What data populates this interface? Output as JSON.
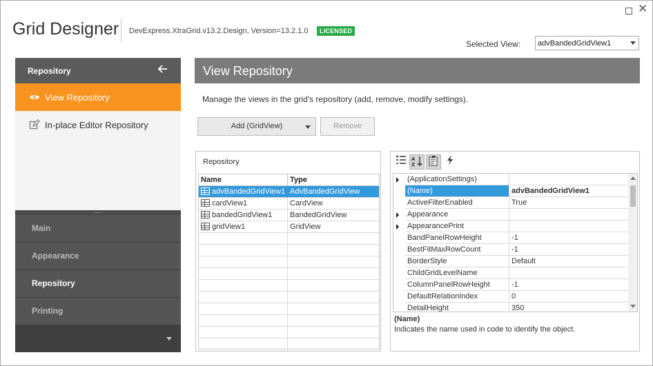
{
  "window": {
    "title": "Grid Designer",
    "version": "DevExpress.XtraGrid.v13.2.Design, Version=13.2.1.0",
    "license_badge": "LICENSED",
    "selected_view_label": "Selected View:",
    "selected_view_value": "advBandedGridView1"
  },
  "nav": {
    "header": "Repository",
    "items": [
      {
        "label": "View Repository",
        "icon": "eye-icon",
        "active": true
      },
      {
        "label": "In-place Editor Repository",
        "icon": "edit-icon",
        "active": false
      }
    ],
    "groups": [
      {
        "label": "Main"
      },
      {
        "label": "Appearance"
      },
      {
        "label": "Repository"
      },
      {
        "label": "Printing"
      }
    ]
  },
  "main": {
    "banner": "View Repository",
    "description": "Manage the views in the grid's repository (add, remove, modify settings).",
    "add_button": "Add (GridView)",
    "remove_button": "Remove"
  },
  "repository": {
    "title": "Repository",
    "columns": [
      "Name",
      "Type"
    ],
    "rows": [
      {
        "name": "advBandedGridView1",
        "type": "AdvBandedGridView"
      },
      {
        "name": "cardView1",
        "type": "CardView"
      },
      {
        "name": "bandedGridView1",
        "type": "BandedGridView"
      },
      {
        "name": "gridView1",
        "type": "GridView"
      }
    ]
  },
  "properties": {
    "rows": [
      {
        "name": "(ApplicationSettings)",
        "value": "",
        "expandable": true
      },
      {
        "name": "(Name)",
        "value": "advBandedGridView1",
        "expandable": false
      },
      {
        "name": "ActiveFilterEnabled",
        "value": "True",
        "expandable": false
      },
      {
        "name": "Appearance",
        "value": "",
        "expandable": true
      },
      {
        "name": "AppearancePrint",
        "value": "",
        "expandable": true
      },
      {
        "name": "BandPanelRowHeight",
        "value": "-1",
        "expandable": false
      },
      {
        "name": "BestFitMaxRowCount",
        "value": "-1",
        "expandable": false
      },
      {
        "name": "BorderStyle",
        "value": "Default",
        "expandable": false
      },
      {
        "name": "ChildGridLevelName",
        "value": "",
        "expandable": false
      },
      {
        "name": "ColumnPanelRowHeight",
        "value": "-1",
        "expandable": false
      },
      {
        "name": "DefaultRelationIndex",
        "value": "0",
        "expandable": false
      },
      {
        "name": "DetailHeight",
        "value": "350",
        "expandable": false
      }
    ],
    "description_title": "(Name)",
    "description_text": "Indicates the name used in code to identify the object."
  },
  "colors": {
    "accent": "#f7931e",
    "selection": "#3399dd",
    "license": "#2aa84a",
    "nav_dark": "#555555"
  }
}
